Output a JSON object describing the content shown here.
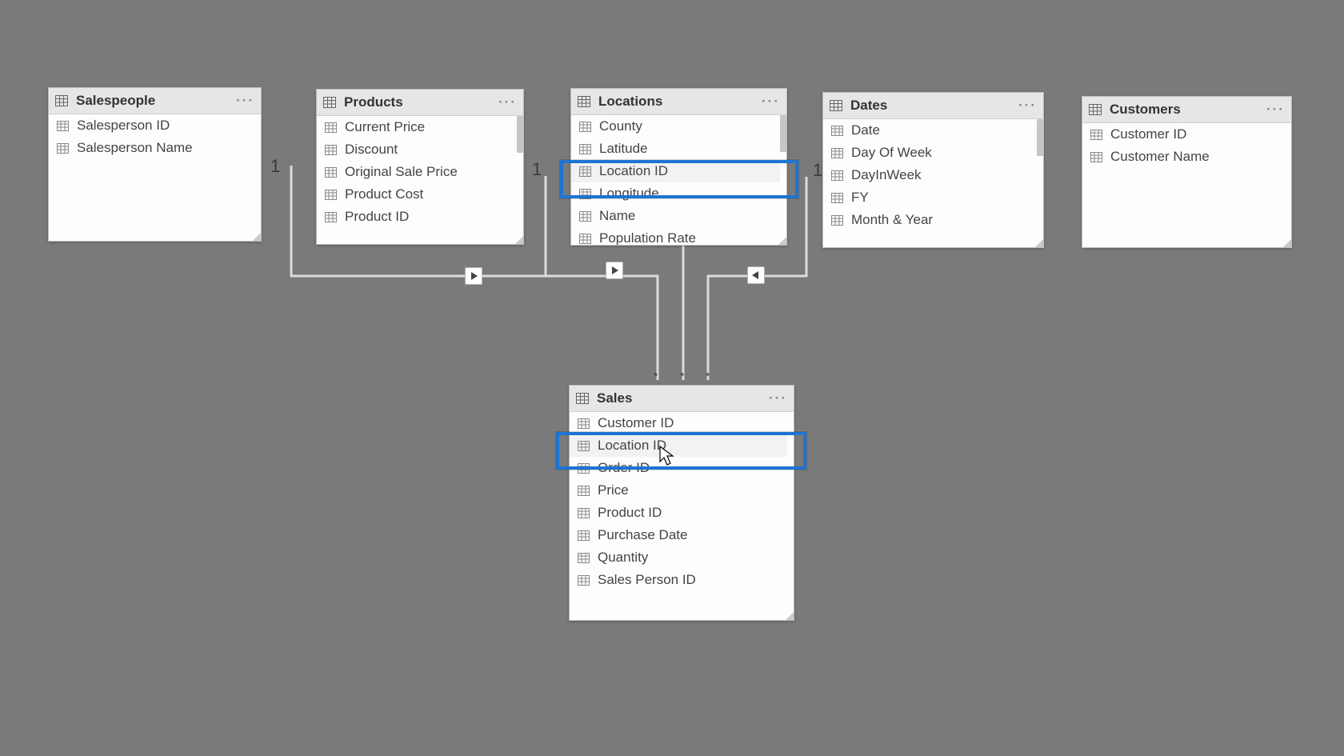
{
  "glyphs": {
    "more": "···",
    "star": "*"
  },
  "cardinality": {
    "salespeople_to_sales": "1",
    "products_to_sales": "1",
    "locations_to_sales": "1",
    "dates_to_sales": "1"
  },
  "tables": {
    "salespeople": {
      "name": "Salespeople",
      "fields": [
        "Salesperson ID",
        "Salesperson Name"
      ]
    },
    "products": {
      "name": "Products",
      "fields": [
        "Current Price",
        "Discount",
        "Original Sale Price",
        "Product Cost",
        "Product ID"
      ]
    },
    "locations": {
      "name": "Locations",
      "fields": [
        "County",
        "Latitude",
        "Location ID",
        "Longitude",
        "Name",
        "Population Rate"
      ]
    },
    "dates": {
      "name": "Dates",
      "fields": [
        "Date",
        "Day Of Week",
        "DayInWeek",
        "FY",
        "Month & Year"
      ]
    },
    "customers": {
      "name": "Customers",
      "fields": [
        "Customer ID",
        "Customer Name"
      ]
    },
    "sales": {
      "name": "Sales",
      "fields": [
        "Customer ID",
        "Location ID",
        "Order ID",
        "Price",
        "Product ID",
        "Purchase Date",
        "Quantity",
        "Sales Person ID"
      ]
    }
  },
  "highlights": {
    "source_table": "Locations",
    "source_field": "Location ID",
    "target_table": "Sales",
    "target_field": "Location ID"
  }
}
